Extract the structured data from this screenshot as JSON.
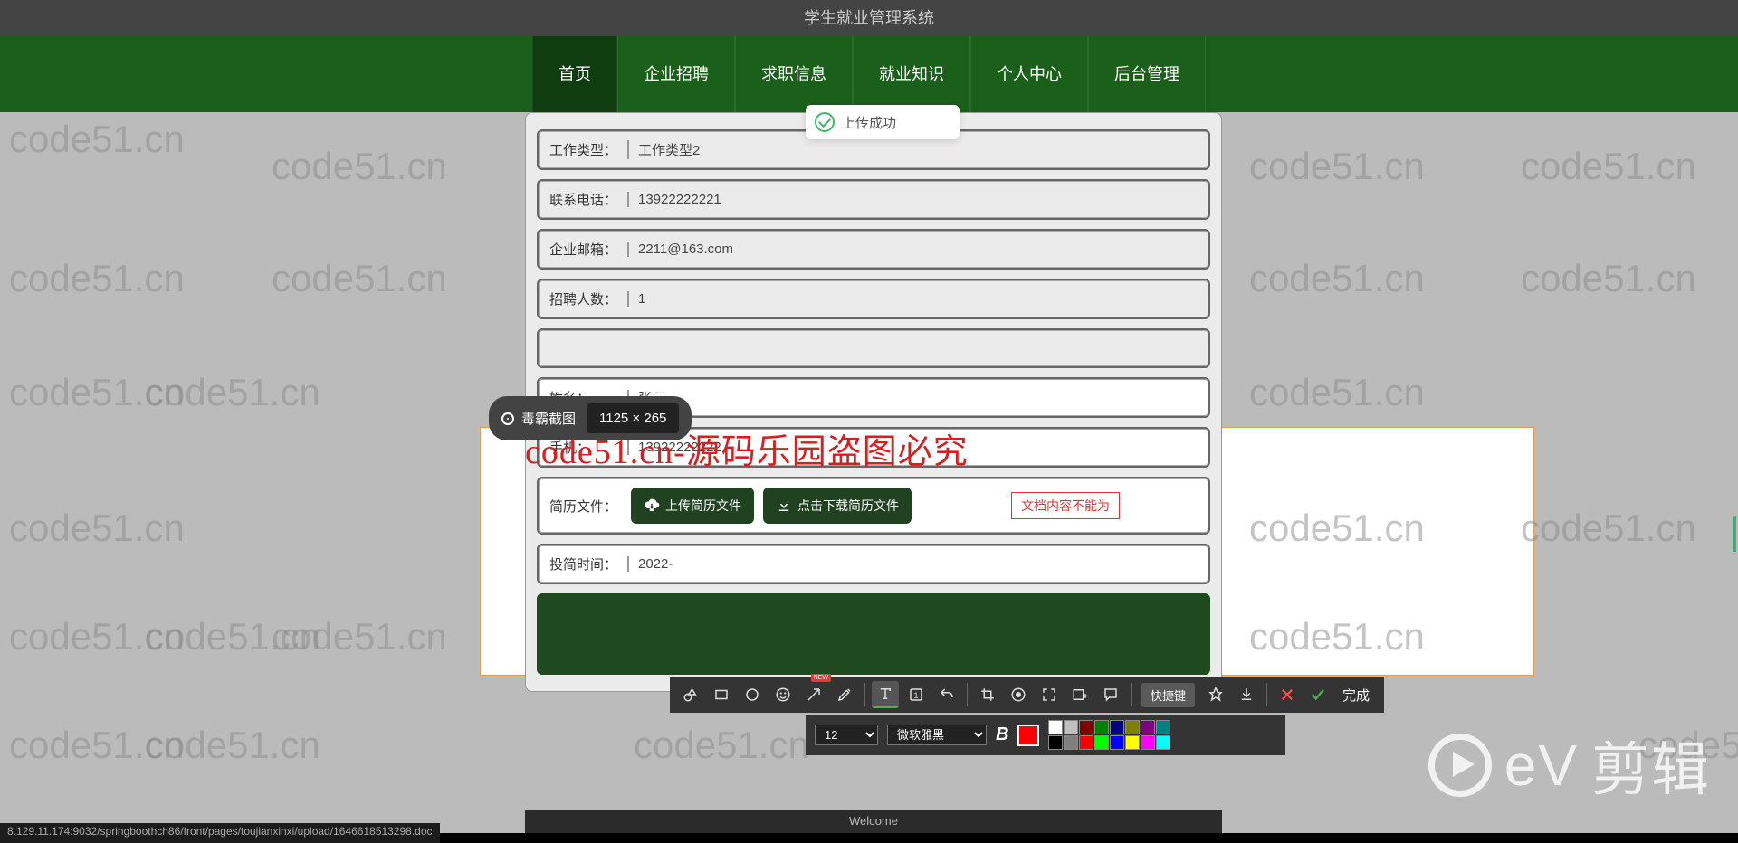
{
  "header": {
    "title": "学生就业管理系统"
  },
  "nav": {
    "items": [
      "首页",
      "企业招聘",
      "求职信息",
      "就业知识",
      "个人中心",
      "后台管理"
    ]
  },
  "toast": {
    "text": "上传成功"
  },
  "form": {
    "work_type": {
      "label": "工作类型：",
      "value": "工作类型2"
    },
    "phone": {
      "label": "联系电话：",
      "value": "13922222221"
    },
    "email": {
      "label": "企业邮箱：",
      "value": "2211@163.com"
    },
    "count": {
      "label": "招聘人数：",
      "value": "1"
    },
    "name": {
      "label": "姓名：",
      "value": "张三"
    },
    "mobile": {
      "label": "手机：",
      "value": "13922222222"
    },
    "resume": {
      "label": "简历文件：",
      "upload": "上传简历文件",
      "download": "点击下载简历文件",
      "error": "文档内容不能为"
    },
    "submit_time": {
      "label": "投简时间：",
      "value": "2022-"
    }
  },
  "screenshot": {
    "tool_name": "毒霸截图",
    "dimensions": "1125 × 265"
  },
  "overlay": {
    "text": "code51.cn-源码乐园盗图必究"
  },
  "toolbar": {
    "shortcut": "快捷键",
    "done": "完成",
    "font_size": "12",
    "font_family": "微软雅黑",
    "palette": [
      "#ffffff",
      "#c0c0c0",
      "#800000",
      "#008000",
      "#000080",
      "#808000",
      "#800080",
      "#008080",
      "#000000",
      "#808080",
      "#ff0000",
      "#00ff00",
      "#0000ff",
      "#ffff00",
      "#ff00ff",
      "#00ffff"
    ]
  },
  "footer": {
    "welcome": "Welcome"
  },
  "status": {
    "path": "8.129.11.174:9032/springboothch86/front/pages/toujianxinxi/upload/1646618513298.doc"
  },
  "watermark": "code51.cn",
  "ev": {
    "brand": "eV",
    "text": "剪辑"
  }
}
